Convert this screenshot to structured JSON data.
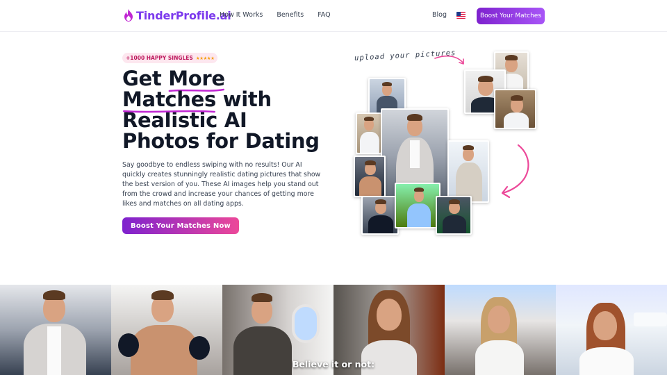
{
  "nav": {
    "logo_text": "TinderProfile.ai",
    "links": [
      "How It Works",
      "Benefits",
      "FAQ"
    ],
    "blog": "Blog",
    "cta": "Boost Your Matches"
  },
  "hero": {
    "badge": "+1000 HAPPY SINGLES",
    "badge_stars": "★★★★★",
    "headline": {
      "line1_a": "Get ",
      "line1_b": "More",
      "line2_a": "Matches",
      "line2_b": " with",
      "line3": "Realistic AI",
      "line4": "Photos for Dating"
    },
    "description": "Say goodbye to endless swiping with no results! Our AI quickly creates stunningly realistic dating pictures that show the best version of you. These AI images help you stand out from the crowd and increase your chances of getting more likes and matches on all dating apps.",
    "cta": "Boost Your Matches Now",
    "upload_note": "upload your pictures"
  },
  "strip": {
    "caption": "Believe it or not:"
  },
  "colors": {
    "brand_purple": "#7c3aed",
    "accent_pink": "#ec4899",
    "badge_bg": "#fde7ef"
  }
}
